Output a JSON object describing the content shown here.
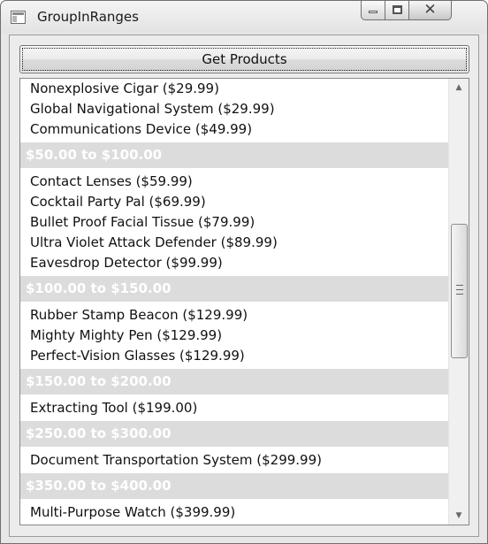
{
  "window": {
    "title": "GroupInRanges",
    "app_icon": "window-app-icon",
    "caption_buttons": {
      "minimize_icon": "minimize-icon",
      "maximize_icon": "maximize-icon",
      "close_glyph": "✕"
    }
  },
  "toolbar": {
    "get_products_label": "Get Products"
  },
  "list": {
    "leading_items": [
      "Nonexplosive Cigar ($29.99)",
      "Global Navigational System ($29.99)",
      "Communications Device ($49.99)"
    ],
    "groups": [
      {
        "header": "$50.00 to $100.00",
        "items": [
          "Contact Lenses ($59.99)",
          "Cocktail Party Pal ($69.99)",
          "Bullet Proof Facial Tissue ($79.99)",
          "Ultra Violet Attack Defender ($89.99)",
          "Eavesdrop Detector ($99.99)"
        ]
      },
      {
        "header": "$100.00 to $150.00",
        "items": [
          "Rubber Stamp Beacon ($129.99)",
          "Mighty Mighty Pen ($129.99)",
          "Perfect-Vision Glasses ($129.99)"
        ]
      },
      {
        "header": "$150.00 to $200.00",
        "items": [
          "Extracting Tool ($199.00)"
        ]
      },
      {
        "header": "$250.00 to $300.00",
        "items": [
          "Document Transportation System ($299.99)"
        ]
      },
      {
        "header": "$350.00 to $400.00",
        "items": [
          "Multi-Purpose Watch ($399.99)"
        ]
      }
    ]
  },
  "scrollbar": {
    "up_arrow": "▲",
    "down_arrow": "▼"
  },
  "colors": {
    "group_header_bg": "#dcdcdc",
    "group_header_text": "#ffffff",
    "list_bg": "#ffffff"
  }
}
